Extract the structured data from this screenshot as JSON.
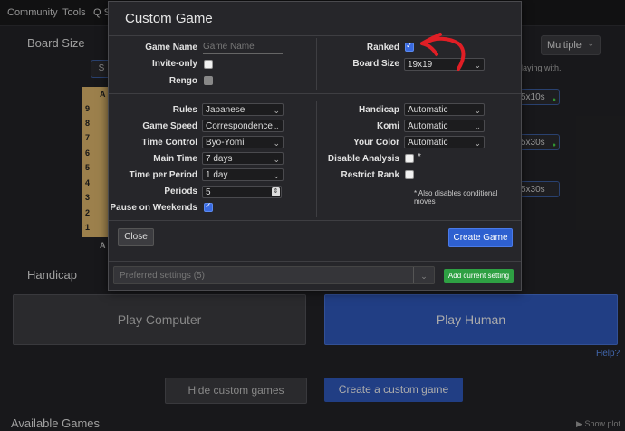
{
  "nav": {
    "community": "Community",
    "tools": "Tools",
    "search_fragment": "Q S"
  },
  "background": {
    "board_size_title": "Board Size",
    "handicap_title": "Handicap",
    "multiple_select": "Multiple",
    "board_size_button_fragment": "S",
    "playing_with_fragment": "laying with.",
    "size_chips": [
      "5x10s",
      "5x30s",
      "5x30s"
    ],
    "board_col_label": "A",
    "board_row_labels": [
      "9",
      "8",
      "7",
      "6",
      "5",
      "4",
      "3",
      "2",
      "1"
    ],
    "board_bottom_col_label": "A",
    "play_computer": "Play Computer",
    "play_human": "Play Human",
    "help_link": "Help?",
    "hide_custom_games": "Hide custom games",
    "create_custom_game": "Create a custom game",
    "available_games": "Available Games",
    "show_plot": "Show plot"
  },
  "modal": {
    "title": "Custom Game",
    "game_name": {
      "label": "Game Name",
      "placeholder": "Game Name"
    },
    "invite_only": {
      "label": "Invite-only",
      "checked": false
    },
    "rengo": {
      "label": "Rengo",
      "checked": false,
      "disabled": true
    },
    "ranked": {
      "label": "Ranked",
      "checked": true
    },
    "board_size": {
      "label": "Board Size",
      "value": "19x19"
    },
    "rules": {
      "label": "Rules",
      "value": "Japanese"
    },
    "game_speed": {
      "label": "Game Speed",
      "value": "Correspondence"
    },
    "time_control": {
      "label": "Time Control",
      "value": "Byo-Yomi"
    },
    "main_time": {
      "label": "Main Time",
      "value": "7 days"
    },
    "time_per_period": {
      "label": "Time per Period",
      "value": "1 day"
    },
    "periods": {
      "label": "Periods",
      "value": "5"
    },
    "pause_on_weekends": {
      "label": "Pause on Weekends",
      "checked": true
    },
    "handicap": {
      "label": "Handicap",
      "value": "Automatic"
    },
    "komi": {
      "label": "Komi",
      "value": "Automatic"
    },
    "your_color": {
      "label": "Your Color",
      "value": "Automatic"
    },
    "disable_analysis": {
      "label": "Disable Analysis",
      "checked": false,
      "asterisk": "*"
    },
    "restrict_rank": {
      "label": "Restrict Rank",
      "checked": false
    },
    "note": "* Also disables conditional moves",
    "close_button": "Close",
    "create_button": "Create Game",
    "preferred_settings": "Preferred settings (5)",
    "add_current_setting": "Add current setting"
  },
  "colors": {
    "accent_blue": "#2e56b8",
    "green": "#2ea043",
    "annotation_red": "#e01e25"
  }
}
